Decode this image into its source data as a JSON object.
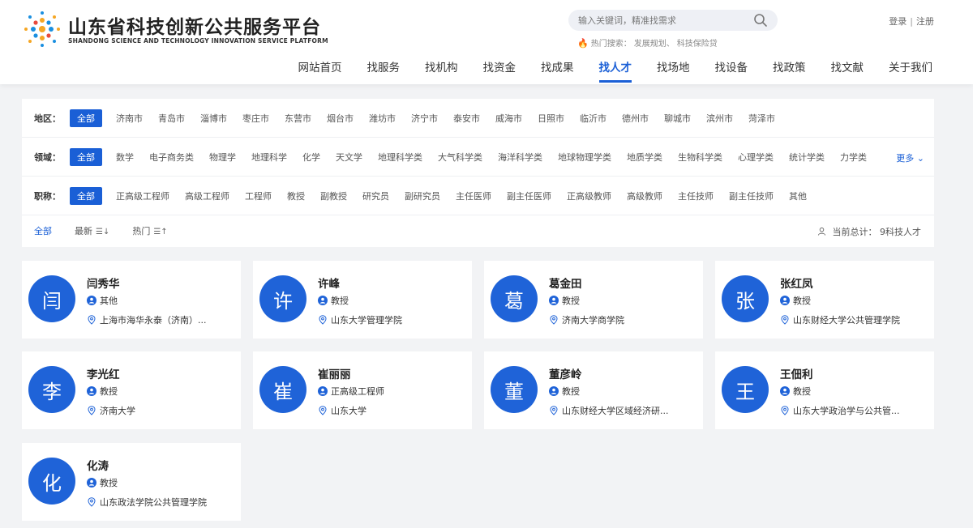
{
  "header": {
    "brand_cn": "山东省科技创新公共服务平台",
    "brand_en": "SHANDONG SCIENCE AND TECHNOLOGY INNOVATION SERVICE PLATFORM",
    "search": {
      "placeholder": "输入关键词，精准找需求"
    },
    "hot": {
      "label": "热门搜索：",
      "items": [
        "发展规划、",
        "科技保险贷"
      ]
    },
    "auth": {
      "login": "登录",
      "sep": "|",
      "register": "注册"
    },
    "nav": [
      "网站首页",
      "找服务",
      "找机构",
      "找资金",
      "找成果",
      "找人才",
      "找场地",
      "找设备",
      "找政策",
      "找文献",
      "关于我们"
    ],
    "nav_active": "找人才"
  },
  "filters": {
    "region": {
      "label": "地区：",
      "options": [
        "全部",
        "济南市",
        "青岛市",
        "淄博市",
        "枣庄市",
        "东营市",
        "烟台市",
        "潍坊市",
        "济宁市",
        "泰安市",
        "威海市",
        "日照市",
        "临沂市",
        "德州市",
        "聊城市",
        "滨州市",
        "菏泽市"
      ]
    },
    "field": {
      "label": "领域：",
      "options": [
        "全部",
        "数学",
        "电子商务类",
        "物理学",
        "地理科学",
        "化学",
        "天文学",
        "地理科学类",
        "大气科学类",
        "海洋科学类",
        "地球物理学类",
        "地质学类",
        "生物科学类",
        "心理学类",
        "统计学类",
        "力学类"
      ],
      "more": "更多"
    },
    "title": {
      "label": "职称：",
      "options": [
        "全部",
        "正高级工程师",
        "高级工程师",
        "工程师",
        "教授",
        "副教授",
        "研究员",
        "副研究员",
        "主任医师",
        "副主任医师",
        "正高级教师",
        "高级教师",
        "主任技师",
        "副主任技师",
        "其他"
      ]
    },
    "sort": [
      "全部",
      "最新",
      "热门"
    ],
    "total": "当前总计：  9科技人才"
  },
  "colors": {
    "accent": "#1a5fd6",
    "avatar": "#1f63d8"
  },
  "cards": [
    {
      "initial": "闫",
      "name": "闫秀华",
      "title": "其他",
      "org": "上海市海华永泰（济南）..."
    },
    {
      "initial": "许",
      "name": "许峰",
      "title": "教授",
      "org": "山东大学管理学院"
    },
    {
      "initial": "葛",
      "name": "葛金田",
      "title": "教授",
      "org": "济南大学商学院"
    },
    {
      "initial": "张",
      "name": "张红凤",
      "title": "教授",
      "org": "山东财经大学公共管理学院"
    },
    {
      "initial": "李",
      "name": "李光红",
      "title": "教授",
      "org": "济南大学"
    },
    {
      "initial": "崔",
      "name": "崔丽丽",
      "title": "正高级工程师",
      "org": "山东大学"
    },
    {
      "initial": "董",
      "name": "董彦岭",
      "title": "教授",
      "org": "山东财经大学区域经济研..."
    },
    {
      "initial": "王",
      "name": "王佃利",
      "title": "教授",
      "org": "山东大学政治学与公共管..."
    },
    {
      "initial": "化",
      "name": "化涛",
      "title": "教授",
      "org": "山东政法学院公共管理学院"
    }
  ]
}
